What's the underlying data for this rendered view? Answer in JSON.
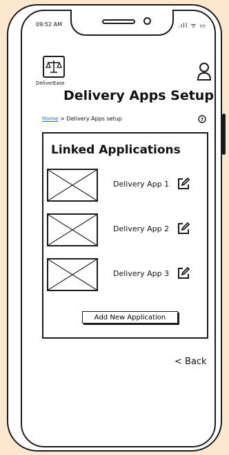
{
  "status_bar": {
    "time": "09:52 AM",
    "icons": ".ıll ᯤ ▭"
  },
  "header": {
    "logo_text": "DeliverEase",
    "title": "Delivery Apps Setup",
    "logo_icon": "scale-icon",
    "profile_icon": "user-icon"
  },
  "breadcrumb": {
    "home": "Home",
    "separator": ">",
    "current": "Delivery Apps setup"
  },
  "linked": {
    "title": "Linked Applications",
    "apps": [
      {
        "name": "Delivery App 1"
      },
      {
        "name": "Delivery App 2"
      },
      {
        "name": "Delivery App 3"
      }
    ],
    "add_button": "Add New Application"
  },
  "footer": {
    "back": "< Back"
  },
  "colors": {
    "background": "#fde7cf",
    "link": "#1a73e8",
    "outline": "#1a1a1a"
  }
}
